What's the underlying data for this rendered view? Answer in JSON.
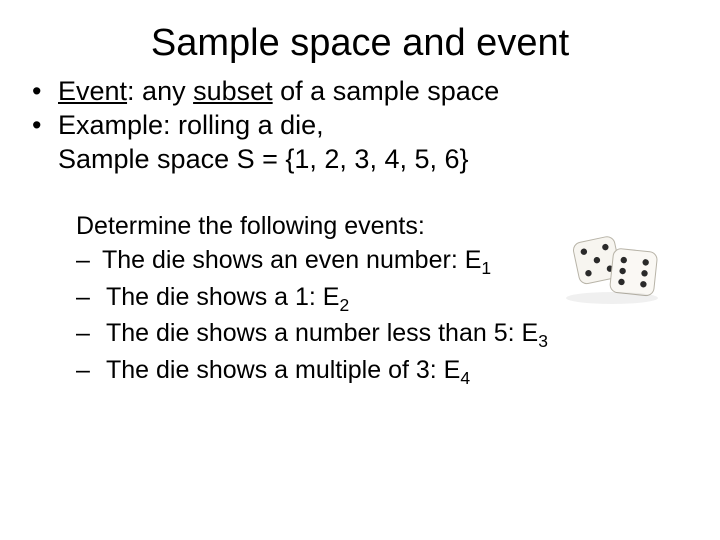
{
  "title": "Sample space and event",
  "bullets": {
    "b1_prefix": "Event",
    "b1_mid": ": any ",
    "b1_underlined": "subset",
    "b1_suffix": " of a sample space",
    "b2": "Example: rolling a die,",
    "b2_line2": "Sample space S = {1, 2, 3, 4, 5, 6}"
  },
  "sub": {
    "intro": "Determine the following events:",
    "i1_text": "The die shows an even number: E",
    "i1_sub": "1",
    "i2_text": " The die shows a 1: E",
    "i2_sub": "2",
    "i3_text": " The die shows a number less than 5: E",
    "i3_sub": "3",
    "i4_text": " The die shows a multiple of 3: E",
    "i4_sub": "4"
  },
  "glyphs": {
    "bullet": "•",
    "dash": "–"
  },
  "image": {
    "name": "dice-icon"
  }
}
